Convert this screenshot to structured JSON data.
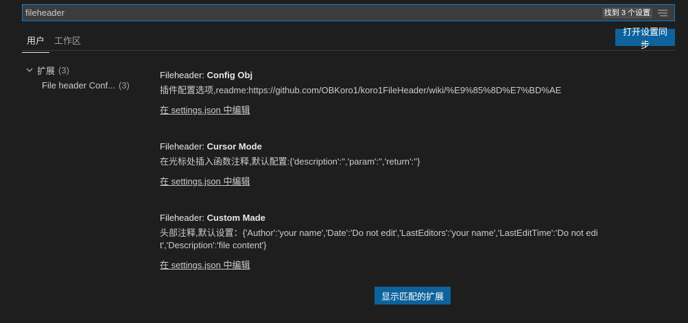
{
  "search": {
    "value": "fileheader",
    "placeholder": "",
    "result_count": "找到 3 个设置"
  },
  "tabs": [
    {
      "label": "用户",
      "active": true
    },
    {
      "label": "工作区",
      "active": false
    }
  ],
  "sync_button": "打开设置同步",
  "tree": {
    "group_label": "扩展",
    "group_count": "(3)",
    "child_label": "File header Conf...",
    "child_count": "(3)"
  },
  "settings": [
    {
      "category": "Fileheader: ",
      "name": "Config Obj",
      "description": "插件配置选项,readme:https://github.com/OBKoro1/koro1FileHeader/wiki/%E9%85%8D%E7%BD%AE",
      "link": "在 settings.json 中编辑"
    },
    {
      "category": "Fileheader: ",
      "name": "Cursor Mode",
      "description": "在光标处插入函数注释,默认配置:{'description':'','param':'','return':''}",
      "link": "在 settings.json 中编辑"
    },
    {
      "category": "Fileheader: ",
      "name": "Custom Made",
      "description": "头部注释,默认设置：{'Author':'your name','Date':'Do not edit','LastEditors':'your name','LastEditTime':'Do not edit','Description':'file content'}",
      "link": "在 settings.json 中编辑"
    }
  ],
  "show_extensions_button": "显示匹配的扩展",
  "icons": {
    "filter": "filter-icon",
    "chevron": "chevron-down-icon"
  },
  "colors": {
    "background": "#1e1e1e",
    "accent": "#0e639c",
    "focus_border": "#007fd4",
    "input_bg": "#3c3c3c"
  }
}
